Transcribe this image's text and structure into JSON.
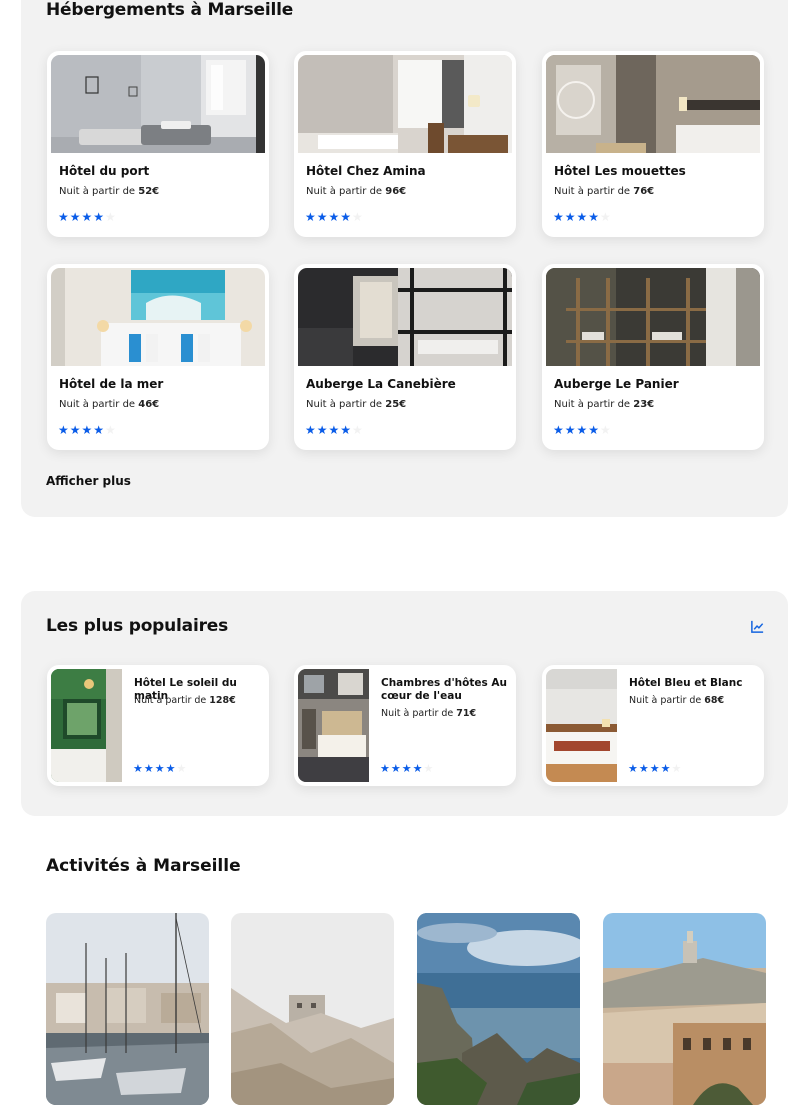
{
  "accommodations": {
    "title": "Hébergements à Marseille",
    "show_more": "Afficher plus",
    "hotels": [
      {
        "name": "Hôtel du port",
        "price_prefix": "Nuit à partir de ",
        "price": "52€",
        "stars": 4
      },
      {
        "name": "Hôtel Chez Amina",
        "price_prefix": "Nuit à partir de ",
        "price": "96€",
        "stars": 4
      },
      {
        "name": "Hôtel Les mouettes",
        "price_prefix": "Nuit à partir de ",
        "price": "76€",
        "stars": 4
      },
      {
        "name": "Hôtel de la mer",
        "price_prefix": "Nuit à partir de ",
        "price": "46€",
        "stars": 4
      },
      {
        "name": "Auberge La Canebière",
        "price_prefix": "Nuit à partir de ",
        "price": "25€",
        "stars": 4
      },
      {
        "name": "Auberge Le Panier",
        "price_prefix": "Nuit à partir de ",
        "price": "23€",
        "stars": 4
      }
    ]
  },
  "popular": {
    "title": "Les plus populaires",
    "icon": "trend-chart-icon",
    "hotels": [
      {
        "name": "Hôtel Le soleil du matin",
        "price_prefix": "Nuit à partir de ",
        "price": "128€",
        "stars": 4
      },
      {
        "name": "Chambres d'hôtes Au cœur de l'eau",
        "price_prefix": "Nuit à partir de ",
        "price": "71€",
        "stars": 4
      },
      {
        "name": "Hôtel Bleu et Blanc",
        "price_prefix": "Nuit à partir de ",
        "price": "68€",
        "stars": 4
      }
    ]
  },
  "activities": {
    "title": "Activités à Marseille"
  },
  "colors": {
    "star": "#0a5ce8",
    "panel": "#f2f2f2",
    "accent": "#1565e0"
  }
}
